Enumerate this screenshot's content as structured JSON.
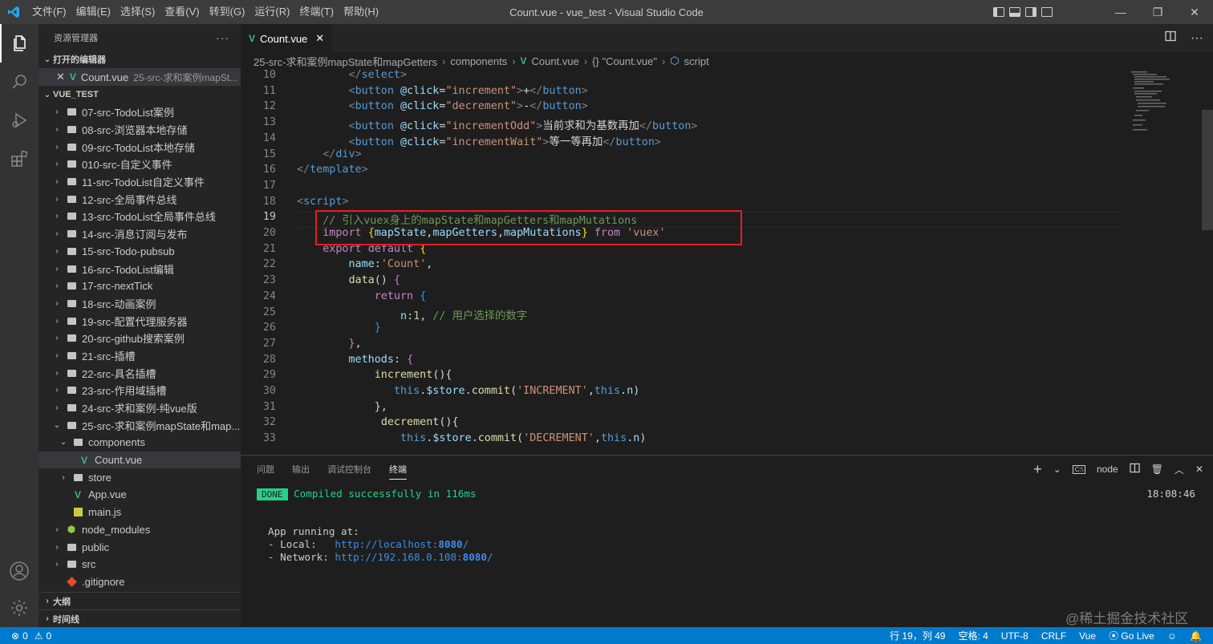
{
  "titlebar": {
    "menus": [
      "文件(F)",
      "编辑(E)",
      "选择(S)",
      "查看(V)",
      "转到(G)",
      "运行(R)",
      "终端(T)",
      "帮助(H)"
    ],
    "title": "Count.vue - vue_test - Visual Studio Code"
  },
  "sidebar": {
    "header": "资源管理器",
    "open_editors_label": "打开的编辑器",
    "open_editor": {
      "name": "Count.vue",
      "desc": "25-src-求和案例mapSt..."
    },
    "project_label": "VUE_TEST",
    "tree": [
      {
        "label": "07-src-TodoList案例",
        "type": "folder",
        "depth": 0,
        "open": false
      },
      {
        "label": "08-src-浏览器本地存储",
        "type": "folder",
        "depth": 0,
        "open": false
      },
      {
        "label": "09-src-TodoList本地存储",
        "type": "folder",
        "depth": 0,
        "open": false
      },
      {
        "label": "010-src-自定义事件",
        "type": "folder",
        "depth": 0,
        "open": false
      },
      {
        "label": "11-src-TodoList自定义事件",
        "type": "folder",
        "depth": 0,
        "open": false
      },
      {
        "label": "12-src-全局事件总线",
        "type": "folder",
        "depth": 0,
        "open": false
      },
      {
        "label": "13-src-TodoList全局事件总线",
        "type": "folder",
        "depth": 0,
        "open": false
      },
      {
        "label": "14-src-消息订阅与发布",
        "type": "folder",
        "depth": 0,
        "open": false
      },
      {
        "label": "15-src-Todo-pubsub",
        "type": "folder",
        "depth": 0,
        "open": false
      },
      {
        "label": "16-src-TodoList编辑",
        "type": "folder",
        "depth": 0,
        "open": false
      },
      {
        "label": "17-src-nextTick",
        "type": "folder",
        "depth": 0,
        "open": false
      },
      {
        "label": "18-src-动画案例",
        "type": "folder",
        "depth": 0,
        "open": false
      },
      {
        "label": "19-src-配置代理服务器",
        "type": "folder",
        "depth": 0,
        "open": false
      },
      {
        "label": "20-src-github搜索案例",
        "type": "folder",
        "depth": 0,
        "open": false
      },
      {
        "label": "21-src-插槽",
        "type": "folder",
        "depth": 0,
        "open": false
      },
      {
        "label": "22-src-具名插槽",
        "type": "folder",
        "depth": 0,
        "open": false
      },
      {
        "label": "23-src-作用域插槽",
        "type": "folder",
        "depth": 0,
        "open": false
      },
      {
        "label": "24-src-求和案例-纯vue版",
        "type": "folder",
        "depth": 0,
        "open": false
      },
      {
        "label": "25-src-求和案例mapState和map...",
        "type": "folder",
        "depth": 0,
        "open": true
      },
      {
        "label": "components",
        "type": "folder",
        "depth": 1,
        "open": true
      },
      {
        "label": "Count.vue",
        "type": "vue",
        "depth": 2,
        "selected": true
      },
      {
        "label": "store",
        "type": "folder",
        "depth": 1,
        "open": false
      },
      {
        "label": "App.vue",
        "type": "vue",
        "depth": 1
      },
      {
        "label": "main.js",
        "type": "js",
        "depth": 1
      },
      {
        "label": "node_modules",
        "type": "node",
        "depth": 0,
        "open": false
      },
      {
        "label": "public",
        "type": "folder",
        "depth": 0,
        "open": false
      },
      {
        "label": "src",
        "type": "folder",
        "depth": 0,
        "open": false
      },
      {
        "label": ".gitignore",
        "type": "git",
        "depth": 0
      }
    ],
    "outline_label": "大纲",
    "timeline_label": "时间线"
  },
  "tab": {
    "label": "Count.vue"
  },
  "breadcrumb": {
    "folder": "25-src-求和案例mapState和mapGetters",
    "sub": "components",
    "file": "Count.vue",
    "obj": "{} \"Count.vue\"",
    "section": "script"
  },
  "editor": {
    "current_line": 19,
    "lines": [
      {
        "n": 10,
        "tokens": [
          [
            "plain",
            "        "
          ],
          [
            "br",
            "</"
          ],
          [
            "tag",
            "select"
          ],
          [
            "br",
            ">"
          ]
        ]
      },
      {
        "n": 11,
        "tokens": [
          [
            "plain",
            "        "
          ],
          [
            "br",
            "<"
          ],
          [
            "tag",
            "button"
          ],
          [
            "plain",
            " "
          ],
          [
            "attr",
            "@click"
          ],
          [
            "plain",
            "="
          ],
          [
            "str",
            "\"increment\""
          ],
          [
            "br",
            ">"
          ],
          [
            "plain",
            "+"
          ],
          [
            "br",
            "</"
          ],
          [
            "tag",
            "button"
          ],
          [
            "br",
            ">"
          ]
        ]
      },
      {
        "n": 12,
        "tokens": [
          [
            "plain",
            "        "
          ],
          [
            "br",
            "<"
          ],
          [
            "tag",
            "button"
          ],
          [
            "plain",
            " "
          ],
          [
            "attr",
            "@click"
          ],
          [
            "plain",
            "="
          ],
          [
            "str",
            "\"decrement\""
          ],
          [
            "br",
            ">"
          ],
          [
            "plain",
            "-"
          ],
          [
            "br",
            "</"
          ],
          [
            "tag",
            "button"
          ],
          [
            "br",
            ">"
          ]
        ]
      },
      {
        "n": 13,
        "tokens": [
          [
            "plain",
            "        "
          ],
          [
            "br",
            "<"
          ],
          [
            "tag",
            "button"
          ],
          [
            "plain",
            " "
          ],
          [
            "attr",
            "@click"
          ],
          [
            "plain",
            "="
          ],
          [
            "str",
            "\"incrementOdd\""
          ],
          [
            "br",
            ">"
          ],
          [
            "plain",
            "当前求和为基数再加"
          ],
          [
            "br",
            "</"
          ],
          [
            "tag",
            "button"
          ],
          [
            "br",
            ">"
          ]
        ]
      },
      {
        "n": 14,
        "tokens": [
          [
            "plain",
            "        "
          ],
          [
            "br",
            "<"
          ],
          [
            "tag",
            "button"
          ],
          [
            "plain",
            " "
          ],
          [
            "attr",
            "@click"
          ],
          [
            "plain",
            "="
          ],
          [
            "str",
            "\"incrementWait\""
          ],
          [
            "br",
            ">"
          ],
          [
            "plain",
            "等一等再加"
          ],
          [
            "br",
            "</"
          ],
          [
            "tag",
            "button"
          ],
          [
            "br",
            ">"
          ]
        ]
      },
      {
        "n": 15,
        "tokens": [
          [
            "plain",
            "    "
          ],
          [
            "br",
            "</"
          ],
          [
            "tag",
            "div"
          ],
          [
            "br",
            ">"
          ]
        ]
      },
      {
        "n": 16,
        "tokens": [
          [
            "br",
            "</"
          ],
          [
            "tag",
            "template"
          ],
          [
            "br",
            ">"
          ]
        ]
      },
      {
        "n": 17,
        "tokens": []
      },
      {
        "n": 18,
        "tokens": [
          [
            "br",
            "<"
          ],
          [
            "tag",
            "script"
          ],
          [
            "br",
            ">"
          ]
        ]
      },
      {
        "n": 19,
        "tokens": [
          [
            "plain",
            "    "
          ],
          [
            "com",
            "// 引入vuex身上的mapState和mapGetters和mapMutations"
          ]
        ]
      },
      {
        "n": 20,
        "tokens": [
          [
            "plain",
            "    "
          ],
          [
            "kw",
            "import"
          ],
          [
            "plain",
            " "
          ],
          [
            "brace",
            "{"
          ],
          [
            "var",
            "mapState"
          ],
          [
            "plain",
            ","
          ],
          [
            "var",
            "mapGetters"
          ],
          [
            "plain",
            ","
          ],
          [
            "var",
            "mapMutations"
          ],
          [
            "brace",
            "}"
          ],
          [
            "plain",
            " "
          ],
          [
            "kw",
            "from"
          ],
          [
            "plain",
            " "
          ],
          [
            "str",
            "'vuex'"
          ]
        ]
      },
      {
        "n": 21,
        "tokens": [
          [
            "plain",
            "    "
          ],
          [
            "kw",
            "export"
          ],
          [
            "plain",
            " "
          ],
          [
            "kw",
            "default"
          ],
          [
            "plain",
            " "
          ],
          [
            "brace",
            "{"
          ]
        ]
      },
      {
        "n": 22,
        "tokens": [
          [
            "plain",
            "        "
          ],
          [
            "var",
            "name"
          ],
          [
            "plain",
            ":"
          ],
          [
            "str",
            "'Count'"
          ],
          [
            "plain",
            ","
          ]
        ]
      },
      {
        "n": 23,
        "tokens": [
          [
            "plain",
            "        "
          ],
          [
            "fn",
            "data"
          ],
          [
            "plain",
            "() "
          ],
          [
            "brace2",
            "{"
          ]
        ]
      },
      {
        "n": 24,
        "tokens": [
          [
            "plain",
            "            "
          ],
          [
            "kw",
            "return"
          ],
          [
            "plain",
            " "
          ],
          [
            "brace3",
            "{"
          ]
        ]
      },
      {
        "n": 25,
        "tokens": [
          [
            "plain",
            "                "
          ],
          [
            "var",
            "n"
          ],
          [
            "plain",
            ":"
          ],
          [
            "num",
            "1"
          ],
          [
            "plain",
            ", "
          ],
          [
            "com",
            "// 用户选择的数字"
          ]
        ]
      },
      {
        "n": 26,
        "tokens": [
          [
            "plain",
            "            "
          ],
          [
            "brace3",
            "}"
          ]
        ]
      },
      {
        "n": 27,
        "tokens": [
          [
            "plain",
            "        "
          ],
          [
            "brace2",
            "}"
          ],
          [
            "plain",
            ","
          ]
        ]
      },
      {
        "n": 28,
        "tokens": [
          [
            "plain",
            "        "
          ],
          [
            "var",
            "methods"
          ],
          [
            "plain",
            ": "
          ],
          [
            "brace2",
            "{"
          ]
        ]
      },
      {
        "n": 29,
        "tokens": [
          [
            "plain",
            "            "
          ],
          [
            "fn",
            "increment"
          ],
          [
            "plain",
            "(){"
          ]
        ]
      },
      {
        "n": 30,
        "tokens": [
          [
            "plain",
            "               "
          ],
          [
            "kw2",
            "this"
          ],
          [
            "plain",
            "."
          ],
          [
            "var",
            "$store"
          ],
          [
            "plain",
            "."
          ],
          [
            "fn",
            "commit"
          ],
          [
            "plain",
            "("
          ],
          [
            "str",
            "'INCREMENT'"
          ],
          [
            "plain",
            ","
          ],
          [
            "kw2",
            "this"
          ],
          [
            "plain",
            "."
          ],
          [
            "var",
            "n"
          ],
          [
            "plain",
            ")"
          ]
        ]
      },
      {
        "n": 31,
        "tokens": [
          [
            "plain",
            "            "
          ],
          [
            "plain",
            "},"
          ]
        ]
      },
      {
        "n": 32,
        "tokens": [
          [
            "plain",
            "             "
          ],
          [
            "fn",
            "decrement"
          ],
          [
            "plain",
            "(){"
          ]
        ]
      },
      {
        "n": 33,
        "tokens": [
          [
            "plain",
            "                "
          ],
          [
            "kw2",
            "this"
          ],
          [
            "plain",
            "."
          ],
          [
            "var",
            "$store"
          ],
          [
            "plain",
            "."
          ],
          [
            "fn",
            "commit"
          ],
          [
            "plain",
            "("
          ],
          [
            "str",
            "'DECREMENT'"
          ],
          [
            "plain",
            ","
          ],
          [
            "kw2",
            "this"
          ],
          [
            "plain",
            "."
          ],
          [
            "var",
            "n"
          ],
          [
            "plain",
            ")"
          ]
        ]
      }
    ]
  },
  "panel": {
    "tabs": [
      "问题",
      "输出",
      "调试控制台",
      "终端"
    ],
    "active_tab": "终端",
    "terminal_name": "node",
    "done_badge": "DONE",
    "compiled": "Compiled successfully in 116ms",
    "time": "18:08:46",
    "app_running": "App running at:",
    "local_label": "- Local:   ",
    "local_url": "http://localhost:",
    "local_port": "8080",
    "network_label": "- Network: ",
    "network_url": "http://192.168.0.108:",
    "network_port": "8080",
    "url_suffix": "/"
  },
  "statusbar": {
    "errors": "0",
    "warnings": "0",
    "position": "行 19，列 49",
    "spaces": "空格: 4",
    "encoding": "UTF-8",
    "eol": "CRLF",
    "language": "Vue",
    "golive": "Go Live"
  },
  "watermark": "@稀土掘金技术社区",
  "colors": {
    "accent": "#007acc",
    "highlight_box": "#e51c23",
    "vue_green": "#41b883"
  }
}
